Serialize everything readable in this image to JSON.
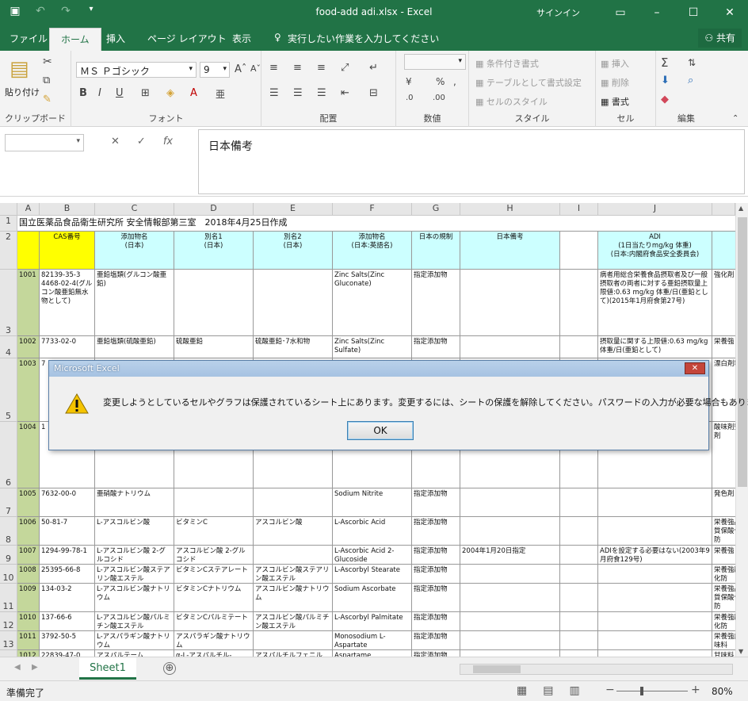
{
  "app": {
    "title": "food-add adi.xlsx - Excel",
    "signin": "サインイン",
    "share": "共有",
    "accent": "#217346"
  },
  "qat": {
    "save_icon": "save-icon",
    "undo_icon": "undo-icon",
    "redo_icon": "redo-icon",
    "customize_icon": "chevron-down-icon"
  },
  "tabs": [
    "ファイル",
    "ホーム",
    "挿入",
    "ページ レイアウト",
    "表示",
    "実行したい作業を入力してください"
  ],
  "ribbon": {
    "paste": "貼り付け",
    "font_name": "ＭＳ Ｐゴシック",
    "font_size": "9",
    "bold": "B",
    "italic": "I",
    "underline": "U",
    "font_color": "A",
    "cond_format": "条件付き書式",
    "table_format": "テーブルとして書式設定",
    "cell_style": "セルのスタイル",
    "insert": "挿入",
    "delete": "削除",
    "format": "書式",
    "groups": {
      "clipboard": "クリップボード",
      "font": "フォント",
      "alignment": "配置",
      "number": "数値",
      "style": "スタイル",
      "cells": "セル",
      "edit": "編集"
    }
  },
  "formula_bar": {
    "cell_ref": "",
    "cancel": "✕",
    "enter": "✓",
    "fx": "fx",
    "content": "日本備考"
  },
  "columns": [
    "A",
    "B",
    "C",
    "D",
    "E",
    "F",
    "G",
    "H",
    "I",
    "J"
  ],
  "title_row": "国立医薬品食品衛生研究所 安全情報部第三室　2018年4月25日作成",
  "headers": {
    "B": "CAS番号",
    "C": "添加物名\n(日本)",
    "D": "別名1\n(日本)",
    "E": "別名2\n(日本)",
    "F": "添加物名\n(日本:英語名)",
    "G": "日本の規制",
    "H": "日本備考",
    "J": "ADI\n(1日当たりmg/kg 体重)\n(日本:内閣府食品安全委員会)"
  },
  "rows": [
    {
      "n": "3",
      "a": "1001",
      "b": "82139-35-3\n4468-02-4(グルコン酸亜鉛無水物として)",
      "c": "亜鉛塩類(グルコン酸亜鉛)",
      "d": "",
      "e": "",
      "f": "Zinc Salts(Zinc Gluconate)",
      "g": "指定添加物",
      "h": "",
      "i": "",
      "j": "病者用総合栄養食品摂取者及び一般摂取者の両者に対する亜鉛摂取量上限値:0.63 mg/kg 体重/日(亜鉛として)(2015年1月府食第27号)",
      "k": "強化剤"
    },
    {
      "n": "4",
      "a": "1002",
      "b": "7733-02-0",
      "c": "亜鉛塩類(硫酸亜鉛)",
      "d": "硫酸亜鉛",
      "e": "硫酸亜鉛･7水和物",
      "f": "Zinc Salts(Zinc Sulfate)",
      "g": "指定添加物",
      "h": "",
      "i": "",
      "j": "摂取量に関する上限値:0.63 mg/kg 体重/日(亜鉛として)",
      "k": "栄養強"
    },
    {
      "n": "5",
      "a": "1003",
      "b": "7",
      "c": "",
      "d": "",
      "e": "",
      "f": "",
      "g": "",
      "h": "",
      "i": "",
      "j": "",
      "k": "漂白剤料"
    },
    {
      "n": "6",
      "a": "1004",
      "b": "1",
      "c": "",
      "d": "",
      "e": "",
      "f": "",
      "g": "",
      "h": "",
      "i": "",
      "j": "",
      "k": "酸味剤整剤"
    },
    {
      "n": "7",
      "a": "1005",
      "b": "7632-00-0",
      "c": "亜硝酸ナトリウム",
      "d": "",
      "e": "",
      "f": "Sodium Nitrite",
      "g": "指定添加物",
      "h": "",
      "i": "",
      "j": "",
      "k": "発色剤"
    },
    {
      "n": "8",
      "a": "1006",
      "b": "50-81-7",
      "c": "L-アスコルビン酸",
      "d": "ビタミンC",
      "e": "アスコルビン酸",
      "f": "L-Ascorbic Acid",
      "g": "指定添加物",
      "h": "",
      "i": "",
      "j": "",
      "k": "栄養強品質保酸化防"
    },
    {
      "n": "9",
      "a": "1007",
      "b": "1294-99-78-1",
      "c": "L-アスコルビン酸 2-グルコシド",
      "d": "アスコルビン酸 2-グルコシド",
      "e": "",
      "f": "L-Ascorbic Acid 2-Glucoside",
      "g": "指定添加物",
      "h": "2004年1月20日指定",
      "i": "",
      "j": "ADIを設定する必要はない(2003年9月府食129号)",
      "k": "栄養強"
    },
    {
      "n": "10",
      "a": "1008",
      "b": "25395-66-8",
      "c": "L-アスコルビン酸ステアリン酸エステル",
      "d": "ビタミンCステアレート",
      "e": "アスコルビン酸ステアリン酸エステル",
      "f": "L-Ascorbyl Stearate",
      "g": "指定添加物",
      "h": "",
      "i": "",
      "j": "",
      "k": "栄養強酸化防"
    },
    {
      "n": "11",
      "a": "1009",
      "b": "134-03-2",
      "c": "L-アスコルビン酸ナトリウム",
      "d": "ビタミンCナトリウム",
      "e": "アスコルビン酸ナトリウム",
      "f": "Sodium Ascorbate",
      "g": "指定添加物",
      "h": "",
      "i": "",
      "j": "",
      "k": "栄養強品質保酸化防"
    },
    {
      "n": "12",
      "a": "1010",
      "b": "137-66-6",
      "c": "L-アスコルビン酸パルミチン酸エステル",
      "d": "ビタミンCパルミテート",
      "e": "アスコルビン酸パルミチン酸エステル",
      "f": "L-Ascorbyl Palmitate",
      "g": "指定添加物",
      "h": "",
      "i": "",
      "j": "",
      "k": "栄養強酸化防"
    },
    {
      "n": "13",
      "a": "1011",
      "b": "3792-50-5",
      "c": "L-アスパラギン酸ナトリウム",
      "d": "アスパラギン酸ナトリウム",
      "e": "",
      "f": "Monosodium L-Aspartate",
      "g": "指定添加物",
      "h": "",
      "i": "",
      "j": "",
      "k": "栄養強調味料"
    },
    {
      "n": "14",
      "a": "1012",
      "b": "22839-47-0",
      "c": "アスパルテーム",
      "d": "α-L-アスパルチル-",
      "e": "アスパルチルフェニル",
      "f": "Aspartame",
      "g": "指定添加物",
      "h": "",
      "i": "",
      "j": "",
      "k": "甘味料"
    }
  ],
  "sheet": {
    "name": "Sheet1",
    "add": "⊕"
  },
  "status": {
    "ready": "準備完了",
    "zoom": "80%",
    "minus": "−",
    "plus": "+"
  },
  "dialog": {
    "title": "Microsoft Excel",
    "message": "変更しようとしているセルやグラフは保護されているシート上にあります。変更するには、シートの保護を解除してください。パスワードの入力が必要な場合もあります。",
    "ok": "OK",
    "close": "✕"
  }
}
